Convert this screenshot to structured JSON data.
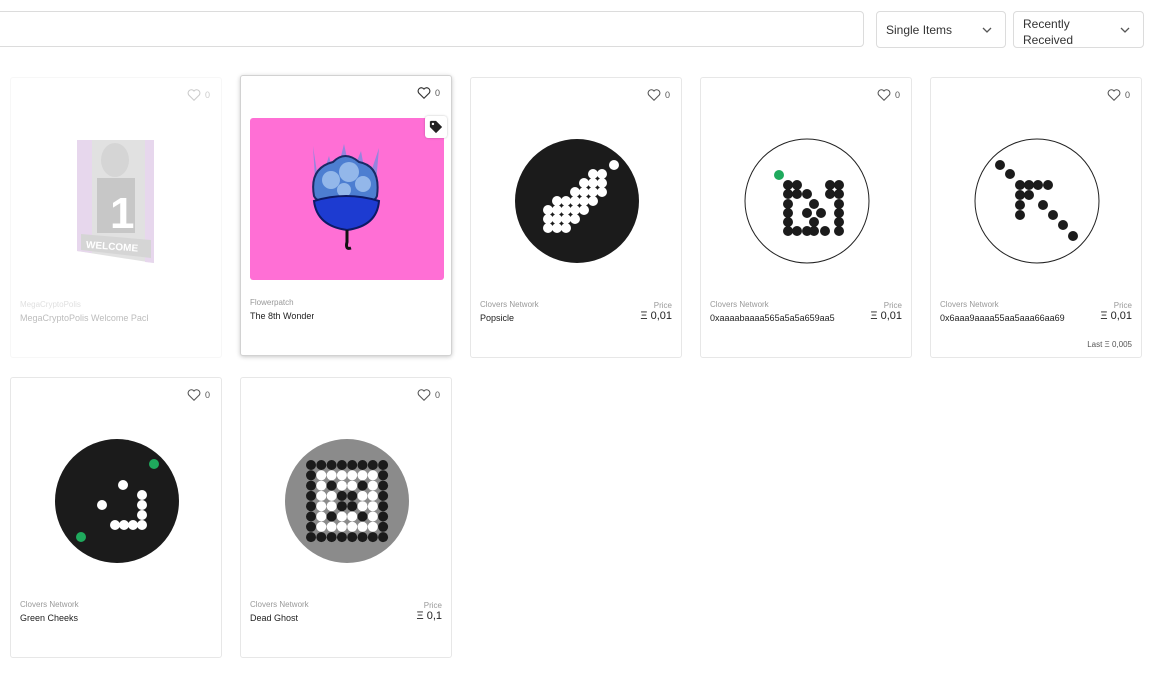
{
  "toolbar": {
    "search_value": "",
    "filter_type": "Single Items",
    "sort": "Recently Received"
  },
  "colors": {
    "pink": "#ff6fd5",
    "clover_dark": "#1b1b1b",
    "clover_gray": "#8b8b8b",
    "clover_green": "#1faa5d"
  },
  "items": [
    {
      "collection": "MegaCryptoPolis",
      "name": "MegaCryptoPolis Welcome Pack",
      "likes": "0",
      "price_label": "",
      "price": "",
      "last": "",
      "art_text": "WELCOME",
      "art_number": "1"
    },
    {
      "collection": "Flowerpatch",
      "name": "The 8th Wonder",
      "likes": "0",
      "price_label": "",
      "price": "",
      "last": ""
    },
    {
      "collection": "Clovers Network",
      "name": "Popsicle",
      "likes": "0",
      "price_label": "Price",
      "price": "Ξ 0,01",
      "last": ""
    },
    {
      "collection": "Clovers Network",
      "name": "0xaaaabaaaa565a5a5a659aa5",
      "likes": "0",
      "price_label": "Price",
      "price": "Ξ 0,01",
      "last": ""
    },
    {
      "collection": "Clovers Network",
      "name": "0x6aaa9aaaa55aa5aaa66aa69",
      "likes": "0",
      "price_label": "Price",
      "price": "Ξ 0,01",
      "last": "Last  Ξ 0,005"
    },
    {
      "collection": "Clovers Network",
      "name": "Green Cheeks",
      "likes": "0",
      "price_label": "",
      "price": "",
      "last": ""
    },
    {
      "collection": "Clovers Network",
      "name": "Dead Ghost",
      "likes": "0",
      "price_label": "Price",
      "price": "Ξ 0,1",
      "last": ""
    }
  ]
}
